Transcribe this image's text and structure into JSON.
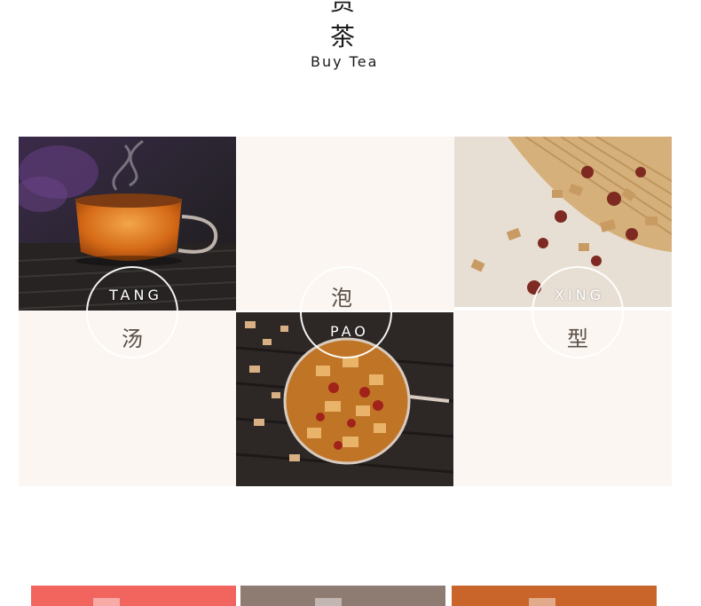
{
  "header": {
    "title_top": "赏",
    "title": "茶",
    "subtitle": "Buy Tea"
  },
  "features": {
    "tang": {
      "en": "TANG",
      "cn": "汤"
    },
    "pao": {
      "cn": "泡",
      "en": "PAO"
    },
    "xing": {
      "en": "XING",
      "cn": "型"
    }
  },
  "colors": {
    "background": "#ffffff",
    "cream": "#fbf6f1",
    "bar_red": "#f2655f",
    "bar_taupe": "#8e7b72",
    "bar_orange": "#c9642a"
  }
}
